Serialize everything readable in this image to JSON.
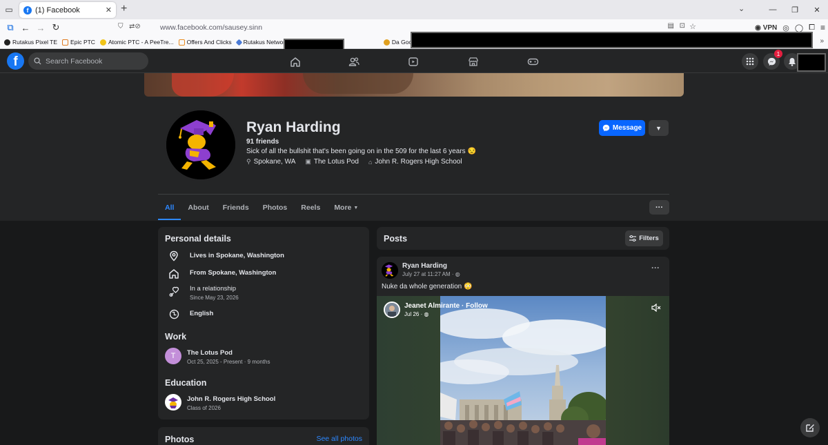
{
  "browser": {
    "tab_title": "(1) Facebook",
    "url": "www.facebook.com/sausey.sinn",
    "vpn_label": "VPN",
    "bookmarks": [
      {
        "label": "Rutakus Pixel TE",
        "color": "#222222"
      },
      {
        "label": "Epic PTC",
        "color": "#e07b20"
      },
      {
        "label": "Atomic PTC - A PeeTre...",
        "color": "#f0c419"
      },
      {
        "label": "Offers And Clicks",
        "color": "#e98b1f"
      },
      {
        "label": "Rutakus Network - Ho...",
        "color": "#4b7bd6"
      },
      {
        "label": "Da Goody Goodz Store",
        "color": "#e0a020"
      }
    ]
  },
  "facebook": {
    "logo_letter": "f",
    "search_placeholder": "Search Facebook",
    "messenger_badge": "1",
    "brand_color": "#0866ff"
  },
  "profile": {
    "name": "Ryan Harding",
    "friends": "91 friends",
    "bio": "Sick of all the bullshit that's been going on in the 509 for the last 6 years 😒",
    "location": "Spokane, WA",
    "work_short": "The Lotus Pod",
    "school_short": "John R. Rogers High School",
    "message_label": "Message",
    "tabs": [
      "All",
      "About",
      "Friends",
      "Photos",
      "Reels",
      "More"
    ]
  },
  "personal_details": {
    "title": "Personal details",
    "lives": "Lives in Spokane, Washington",
    "from": "From Spokane, Washington",
    "relationship": "In a relationship",
    "relationship_since": "Since May 23, 2026",
    "language": "English"
  },
  "work": {
    "title": "Work",
    "company": "The Lotus Pod",
    "initial": "T",
    "dates": "Oct 25, 2025 - Present · 9 months"
  },
  "education": {
    "title": "Education",
    "school": "John R. Rogers High School",
    "class_of": "Class of 2026"
  },
  "photos": {
    "title": "Photos",
    "see_all": "See all photos"
  },
  "posts": {
    "title": "Posts",
    "filters_label": "Filters",
    "post": {
      "author": "Ryan Harding",
      "time": "July 27 at 11:27 AM ·",
      "text": "Nuke da whole generation 😳",
      "shared_author": "Jeanet Almirante · Follow",
      "shared_time": "Jul 26 ·"
    }
  }
}
